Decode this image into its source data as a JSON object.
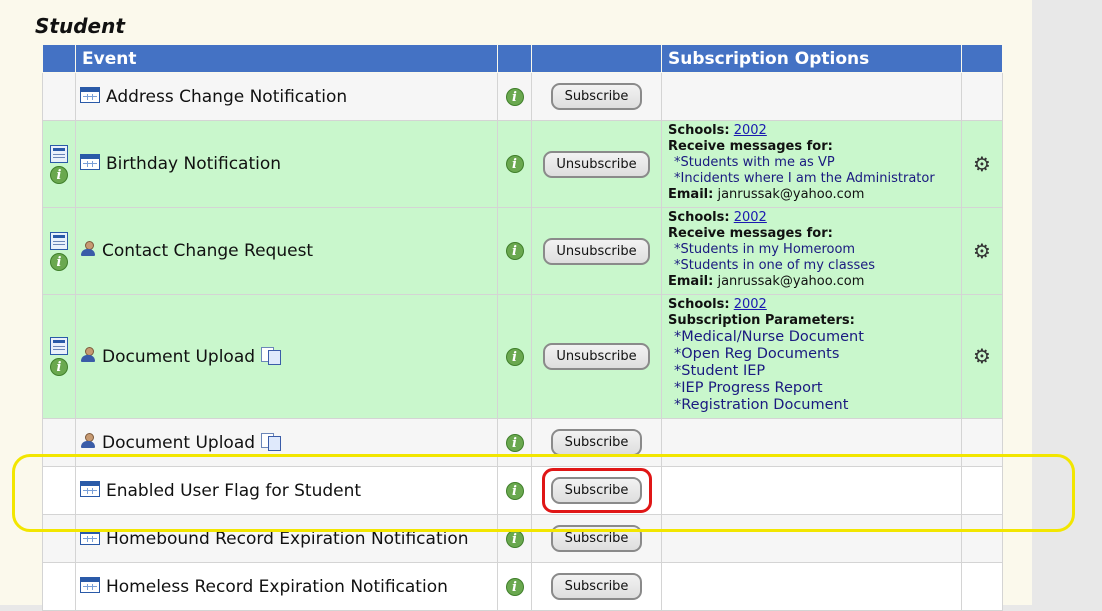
{
  "section_title": "Student",
  "headers": {
    "event": "Event",
    "options": "Subscription Options"
  },
  "rows": [
    {
      "event": "Address Change Notification",
      "icon": "calendar-icon",
      "button": "Subscribe"
    },
    {
      "event": "Birthday Notification",
      "icon": "calendar-icon",
      "button": "Unsubscribe",
      "schools_label": "Schools:",
      "schools": "2002",
      "receive_label": "Receive messages for:",
      "messages": [
        "*Students with me as VP",
        "*Incidents where I am the Administrator"
      ],
      "email_label": "Email:",
      "email": "janrussak@yahoo.com"
    },
    {
      "event": "Contact Change Request",
      "icon": "person-icon",
      "button": "Unsubscribe",
      "schools_label": "Schools:",
      "schools": "2002",
      "receive_label": "Receive messages for:",
      "messages": [
        "*Students in my Homeroom",
        "*Students in one of my classes"
      ],
      "email_label": "Email:",
      "email": "janrussak@yahoo.com"
    },
    {
      "event": "Document Upload",
      "icon": "person-icon",
      "button": "Unsubscribe",
      "schools_label": "Schools:",
      "schools": "2002",
      "params_label": "Subscription Parameters:",
      "params": [
        "*Medical/Nurse Document",
        "*Open Reg Documents",
        "*Student IEP",
        "*IEP Progress Report",
        "*Registration Document"
      ]
    },
    {
      "event": "Document Upload",
      "icon": "person-icon",
      "button": "Subscribe"
    },
    {
      "event": "Enabled User Flag for Student",
      "icon": "calendar-icon",
      "button": "Subscribe"
    },
    {
      "event": "Homebound Record Expiration Notification",
      "icon": "calendar-icon",
      "button": "Subscribe"
    },
    {
      "event": "Homeless Record Expiration Notification",
      "icon": "calendar-icon",
      "button": "Subscribe"
    }
  ],
  "colors": {
    "header": "#4472c4",
    "subscribed_row": "#c9f7cc",
    "highlight_yellow": "#f2e600",
    "highlight_red": "#e01616"
  }
}
